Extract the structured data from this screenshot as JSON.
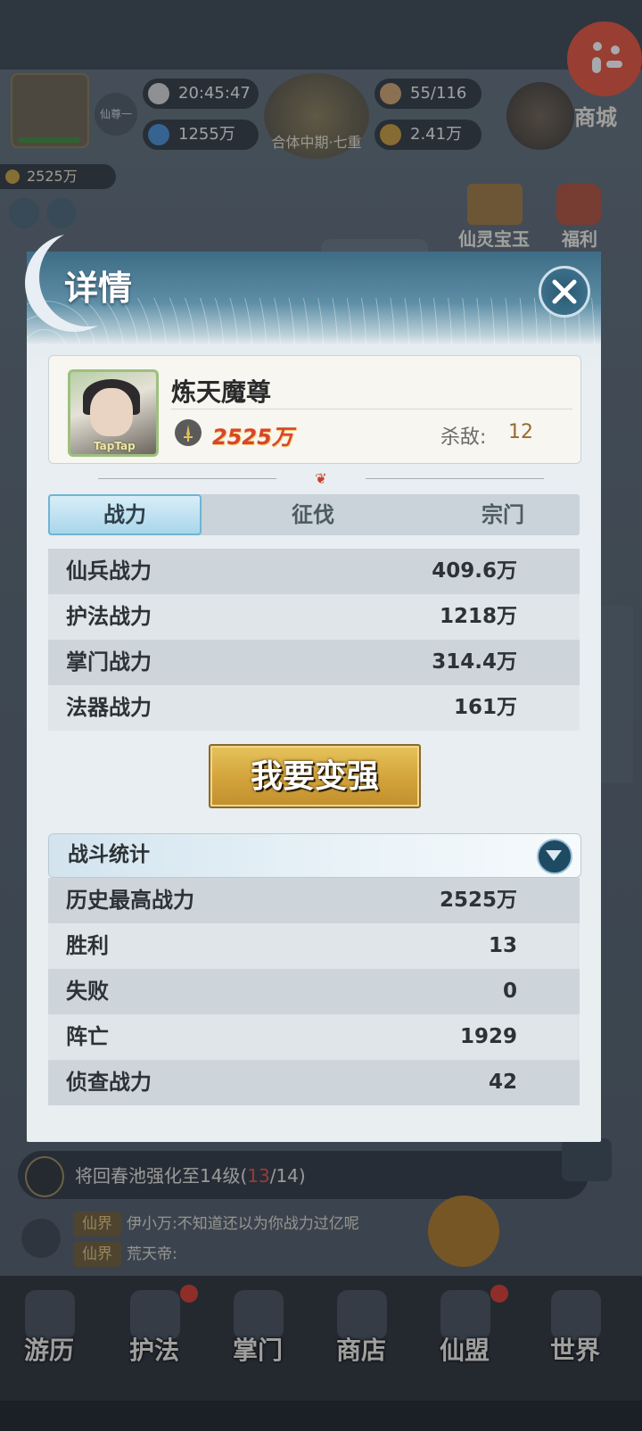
{
  "hud": {
    "time": "20:45:47",
    "stamina": "55/116",
    "spirit_stones": "1255万",
    "gold": "2.41万",
    "realm": "合体中期·七重",
    "realm_button": "仙尊一",
    "shop": "商城",
    "player_power": "2525万",
    "treasure_king": "仙灵宝玉",
    "welfare": "福利"
  },
  "modal": {
    "title": "详情",
    "player": {
      "name": "炼天魔尊",
      "power": "2525万",
      "kills_label": "杀敌:",
      "kills": "12",
      "avatar_tag": "TapTap"
    },
    "tabs": [
      {
        "label": "战力",
        "active": true
      },
      {
        "label": "征伐",
        "active": false
      },
      {
        "label": "宗门",
        "active": false
      }
    ],
    "power_stats": [
      {
        "label": "仙兵战力",
        "value": "409.6万"
      },
      {
        "label": "护法战力",
        "value": "1218万"
      },
      {
        "label": "掌门战力",
        "value": "314.4万"
      },
      {
        "label": "法器战力",
        "value": "161万"
      }
    ],
    "strong_button": "我要变强",
    "battle_section": {
      "title": "战斗统计",
      "rows": [
        {
          "label": "历史最高战力",
          "value": "2525万"
        },
        {
          "label": "胜利",
          "value": "13"
        },
        {
          "label": "失败",
          "value": "0"
        },
        {
          "label": "阵亡",
          "value": "1929"
        },
        {
          "label": "侦查战力",
          "value": "42"
        }
      ]
    }
  },
  "task": {
    "text": "将回春池强化至14级(",
    "progress_current": "13",
    "progress_rest": "/14)"
  },
  "chat": [
    {
      "channel": "仙界",
      "text": "伊小万:不知道还以为你战力过亿呢"
    },
    {
      "channel": "仙界",
      "text": "荒天帝:"
    }
  ],
  "nav": [
    {
      "label": "游历",
      "badge": false
    },
    {
      "label": "护法",
      "badge": true
    },
    {
      "label": "掌门",
      "badge": false
    },
    {
      "label": "商店",
      "badge": false
    },
    {
      "label": "仙盟",
      "badge": true
    },
    {
      "label": "世界",
      "badge": false
    }
  ],
  "colors": {
    "accent_blue": "#3e6c86",
    "gold_button": "#d3a33a",
    "power_red": "#d8452e",
    "badge_red": "#d7392c"
  }
}
